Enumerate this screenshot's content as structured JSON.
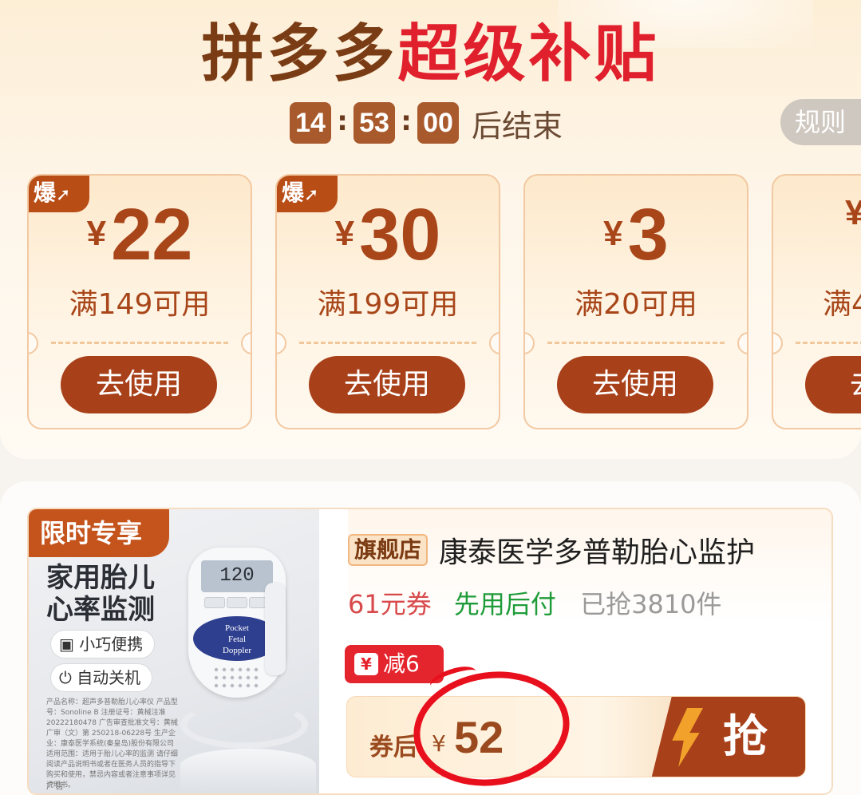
{
  "header": {
    "brand": "拼多多",
    "highlight": "超级补贴",
    "countdown": {
      "hours": "14",
      "minutes": "53",
      "seconds": "00",
      "suffix": "后结束"
    },
    "rules_label": "规则"
  },
  "coupons": [
    {
      "badge": "爆",
      "currency": "¥",
      "amount": "22",
      "condition": "满149可用",
      "button": "去使用"
    },
    {
      "badge": "爆",
      "currency": "¥",
      "amount": "30",
      "condition": "满199可用",
      "button": "去使用"
    },
    {
      "badge": "",
      "currency": "¥",
      "amount": "3",
      "condition": "满20可用",
      "button": "去使用"
    },
    {
      "badge": "",
      "currency": "¥",
      "amount": "",
      "condition": "满4",
      "button": "去"
    }
  ],
  "product": {
    "image": {
      "limited_label": "限时专享",
      "headline_1": "家用胎儿",
      "headline_2": "心率监测",
      "feature_1": "小巧便携",
      "feature_2": "自动关机",
      "screen_reading": "120",
      "device_label_1": "Pocket",
      "device_label_2": "Fetal",
      "device_label_3": "Doppler",
      "fine_print": "产品名称：超声多普勒胎儿心率仪 产品型号：Sonoline B 注册证号：黄械注准20222180478 广告审查批准文号：黄械广审（文）第 250218-06228号 生产企业：康泰医学系统(秦皇岛)股份有限公司 适用范围：适用于胎儿心率的监测 请仔细阅读产品说明书或者在医务人员的指导下购买和使用，禁忌内容或者注意事项详见说明书。",
      "ad_label": "广告"
    },
    "store_tag": "旗舰店",
    "title": "康泰医学多普勒胎心监护",
    "coupon_text": "61元券",
    "pay_later": "先用后付",
    "sold": "已抢3810件",
    "discount_icon": "¥",
    "discount": "减6",
    "after_coupon_label": "券后",
    "currency": "¥",
    "price": "52",
    "grab_button": "抢"
  },
  "colors": {
    "accent": "#a8401a",
    "highlight_red": "#e0202c",
    "annotation_red": "#e8101c",
    "pay_green": "#1f9c3a"
  }
}
